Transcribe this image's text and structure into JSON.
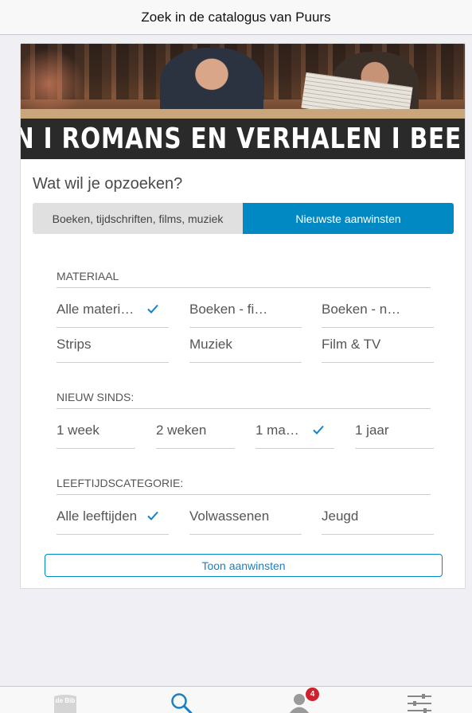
{
  "topbar": {
    "title": "Zoek in de catalogus van Puurs"
  },
  "hero": {
    "banner_text": "N I ROMANS EN VERHALEN I BEE"
  },
  "card": {
    "title": "Wat wil je opzoeken?",
    "tabs": [
      {
        "label": "Boeken, tijdschriften, films, muziek",
        "active": false
      },
      {
        "label": "Nieuwste aanwinsten",
        "active": true
      }
    ]
  },
  "materiaal": {
    "heading": "MATERIAAL",
    "options": [
      {
        "label": "Alle materi…",
        "selected": true
      },
      {
        "label": "Boeken - fi…",
        "selected": false
      },
      {
        "label": "Boeken - n…",
        "selected": false
      },
      {
        "label": "Strips",
        "selected": false
      },
      {
        "label": "Muziek",
        "selected": false
      },
      {
        "label": "Film & TV",
        "selected": false
      }
    ]
  },
  "nieuw_sinds": {
    "heading": "NIEUW SINDS:",
    "options": [
      {
        "label": "1 week",
        "selected": false
      },
      {
        "label": "2 weken",
        "selected": false
      },
      {
        "label": "1 ma…",
        "selected": true
      },
      {
        "label": "1 jaar",
        "selected": false
      }
    ]
  },
  "leeftijd": {
    "heading": "LEEFTIJDSCATEGORIE:",
    "options": [
      {
        "label": "Alle leeftijden",
        "selected": true
      },
      {
        "label": "Volwassenen",
        "selected": false
      },
      {
        "label": "Jeugd",
        "selected": false
      }
    ]
  },
  "action": {
    "label": "Toon aanwinsten"
  },
  "bottombar": {
    "logo_text": "de Bib",
    "account_badge": "4",
    "icons": [
      "bib-logo-icon",
      "search-icon",
      "user-icon",
      "sliders-icon"
    ]
  },
  "colors": {
    "accent": "#0089c3",
    "check": "#1a7fc4",
    "badge": "#d0202c"
  }
}
